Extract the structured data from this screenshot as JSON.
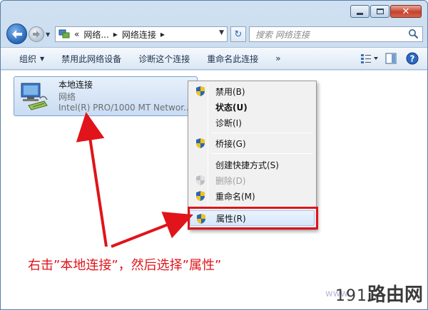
{
  "address": {
    "path": [
      "网络...",
      "网络连接"
    ],
    "separator": "▸",
    "prefix": "«"
  },
  "search": {
    "placeholder": "搜索 网络连接"
  },
  "toolbar": {
    "items": [
      {
        "label": "组织",
        "has_caret": true
      },
      {
        "label": "禁用此网络设备"
      },
      {
        "label": "诊断这个连接"
      },
      {
        "label": "重命名此连接"
      },
      {
        "label": "»"
      }
    ]
  },
  "connection": {
    "name": "本地连接",
    "network": "网络",
    "device": "Intel(R) PRO/1000 MT Networ..."
  },
  "context_menu": {
    "items": [
      {
        "label": "禁用(B)",
        "shield": true
      },
      {
        "label": "状态(U)",
        "bold": true
      },
      {
        "label": "诊断(I)"
      },
      {
        "label": "桥接(G)",
        "shield": true
      },
      {
        "label": "创建快捷方式(S)"
      },
      {
        "label": "删除(D)",
        "shield": true,
        "disabled": true
      },
      {
        "label": "重命名(M)",
        "shield": true
      },
      {
        "label": "属性(R)",
        "shield": true,
        "highlight": true
      }
    ]
  },
  "annotation": "右击”本地连接”，然后选择”属性”",
  "watermark": {
    "number": "191",
    "text": "路由网",
    "faint": "www."
  },
  "colors": {
    "annotation_red": "#e0141a",
    "accent_blue": "#2566b6"
  }
}
